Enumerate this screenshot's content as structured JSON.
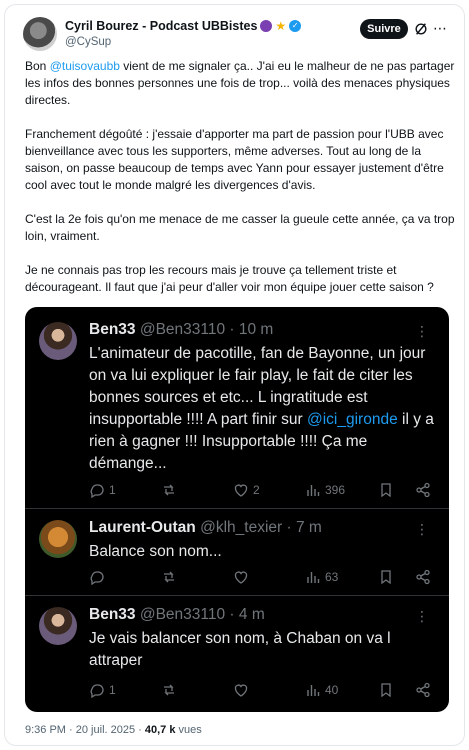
{
  "post": {
    "author_name": "Cyril Bourez - Podcast UBBistes",
    "author_handle": "@CySup",
    "follow_label": "Suivre",
    "badges": [
      "grapes-icon",
      "star-icon",
      "verified-icon"
    ],
    "paragraph1_prefix": "Bon ",
    "paragraph1_mention": "@tuisovaubb",
    "paragraph1_suffix": " vient de me signaler ça.. J'ai eu le malheur de ne pas partager les infos des bonnes personnes une fois de trop... voilà des menaces physiques directes.",
    "paragraph2": "Franchement dégoûté : j'essaie d'apporter ma part de passion pour l'UBB avec bienveillance avec tous les supporters, même adverses. Tout au long de la saison, on passe beaucoup de temps avec Yann pour essayer justement d'être cool avec tout le monde malgré les divergences d'avis.",
    "paragraph3": "C'est la 2e fois qu'on me menace de me casser la gueule cette année, ça va trop loin, vraiment.",
    "paragraph4": "Je ne connais pas trop les recours mais je trouve ça tellement triste et décourageant. Il faut que j'ai peur d'aller voir mon équipe jouer cette saison ?",
    "time": "9:36 PM",
    "date": "20 juil. 2025",
    "views_count": "40,7 k",
    "views_label": "vues"
  },
  "screenshot": {
    "replies": [
      {
        "name": "Ben33",
        "handle": "@Ben33110",
        "time": "· 10 m",
        "text_before": "L'animateur de pacotille, fan de Bayonne, un jour on va lui expliquer le fair play, le fait de citer les bonnes sources et etc... L ingratitude est insupportable !!!! A part finir sur ",
        "mention": "@ici_gironde",
        "text_after": " il y a rien à gagner !!! Insupportable !!!! Ça me démange...",
        "replies": "1",
        "reposts": "",
        "likes": "2",
        "views": "396"
      },
      {
        "name": "Laurent-Outan",
        "handle": "@klh_texier",
        "time": "· 7 m",
        "text": "Balance son nom...",
        "replies": "",
        "reposts": "",
        "likes": "",
        "views": "63"
      },
      {
        "name": "Ben33",
        "handle": "@Ben33110",
        "time": "· 4 m",
        "text": "Je vais balancer son nom, à Chaban on va l attraper",
        "replies": "1",
        "reposts": "",
        "likes": "",
        "views": "40"
      }
    ]
  },
  "colors": {
    "accent": "#1d9bf0",
    "dark_bg": "#000000",
    "muted": "#71767b"
  }
}
